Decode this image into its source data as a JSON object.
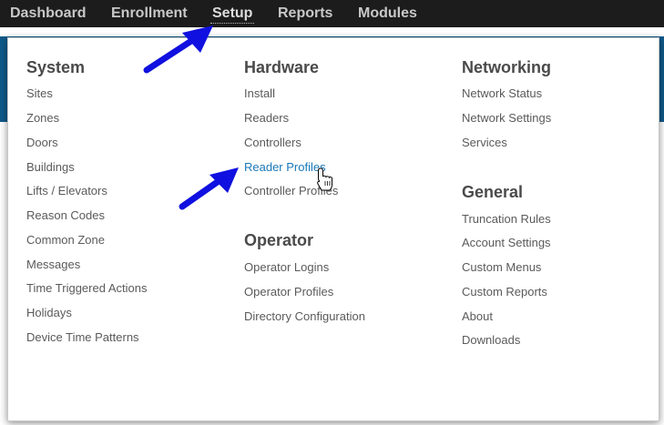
{
  "nav": {
    "items": [
      {
        "label": "Dashboard"
      },
      {
        "label": "Enrollment"
      },
      {
        "label": "Setup"
      },
      {
        "label": "Reports"
      },
      {
        "label": "Modules"
      }
    ]
  },
  "menu": {
    "system": {
      "heading": "System",
      "items": [
        "Sites",
        "Zones",
        "Doors",
        "Buildings",
        "Lifts / Elevators",
        "Reason Codes",
        "Common Zone",
        "Messages",
        "Time Triggered Actions",
        "Holidays",
        "Device Time Patterns"
      ]
    },
    "hardware": {
      "heading": "Hardware",
      "items": [
        "Install",
        "Readers",
        "Controllers",
        "Reader Profiles",
        "Controller Profiles"
      ]
    },
    "operator": {
      "heading": "Operator",
      "items": [
        "Operator Logins",
        "Operator Profiles",
        "Directory Configuration"
      ]
    },
    "networking": {
      "heading": "Networking",
      "items": [
        "Network Status",
        "Network Settings",
        "Services"
      ]
    },
    "general": {
      "heading": "General",
      "items": [
        "Truncation Rules",
        "Account Settings",
        "Custom Menus",
        "Custom Reports",
        "About",
        "Downloads"
      ]
    }
  },
  "colors": {
    "arrow": "#1010e0",
    "hover_link": "#1a78b8",
    "nav_bg": "#1c1c1c"
  },
  "icons": {
    "cursor": "hand-pointer-icon",
    "annotation": "blue-arrow-icon"
  }
}
